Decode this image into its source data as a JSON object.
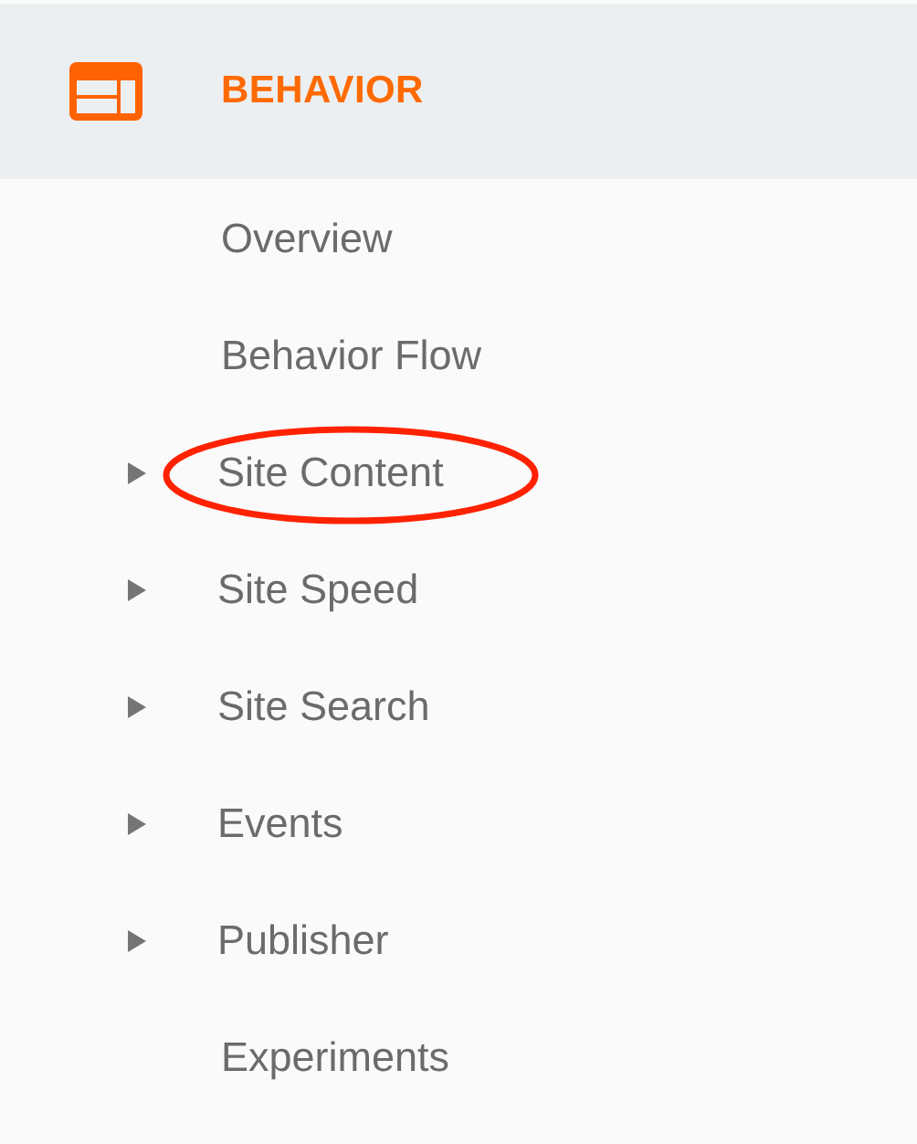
{
  "section": {
    "title": "BEHAVIOR"
  },
  "items": [
    {
      "label": "Overview",
      "kind": "link",
      "circled": false
    },
    {
      "label": "Behavior Flow",
      "kind": "link",
      "circled": false
    },
    {
      "label": "Site Content",
      "kind": "group",
      "circled": true
    },
    {
      "label": "Site Speed",
      "kind": "group",
      "circled": false
    },
    {
      "label": "Site Search",
      "kind": "group",
      "circled": false
    },
    {
      "label": "Events",
      "kind": "group",
      "circled": false
    },
    {
      "label": "Publisher",
      "kind": "group",
      "circled": false
    },
    {
      "label": "Experiments",
      "kind": "link",
      "circled": false
    }
  ]
}
